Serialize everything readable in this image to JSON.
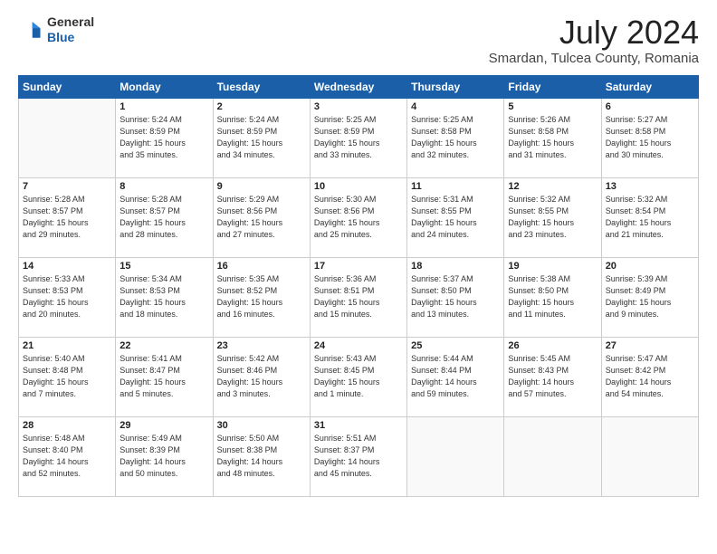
{
  "header": {
    "logo_line1": "General",
    "logo_line2": "Blue",
    "month_year": "July 2024",
    "location": "Smardan, Tulcea County, Romania"
  },
  "weekdays": [
    "Sunday",
    "Monday",
    "Tuesday",
    "Wednesday",
    "Thursday",
    "Friday",
    "Saturday"
  ],
  "weeks": [
    [
      {
        "day": "",
        "info": ""
      },
      {
        "day": "1",
        "info": "Sunrise: 5:24 AM\nSunset: 8:59 PM\nDaylight: 15 hours\nand 35 minutes."
      },
      {
        "day": "2",
        "info": "Sunrise: 5:24 AM\nSunset: 8:59 PM\nDaylight: 15 hours\nand 34 minutes."
      },
      {
        "day": "3",
        "info": "Sunrise: 5:25 AM\nSunset: 8:59 PM\nDaylight: 15 hours\nand 33 minutes."
      },
      {
        "day": "4",
        "info": "Sunrise: 5:25 AM\nSunset: 8:58 PM\nDaylight: 15 hours\nand 32 minutes."
      },
      {
        "day": "5",
        "info": "Sunrise: 5:26 AM\nSunset: 8:58 PM\nDaylight: 15 hours\nand 31 minutes."
      },
      {
        "day": "6",
        "info": "Sunrise: 5:27 AM\nSunset: 8:58 PM\nDaylight: 15 hours\nand 30 minutes."
      }
    ],
    [
      {
        "day": "7",
        "info": "Sunrise: 5:28 AM\nSunset: 8:57 PM\nDaylight: 15 hours\nand 29 minutes."
      },
      {
        "day": "8",
        "info": "Sunrise: 5:28 AM\nSunset: 8:57 PM\nDaylight: 15 hours\nand 28 minutes."
      },
      {
        "day": "9",
        "info": "Sunrise: 5:29 AM\nSunset: 8:56 PM\nDaylight: 15 hours\nand 27 minutes."
      },
      {
        "day": "10",
        "info": "Sunrise: 5:30 AM\nSunset: 8:56 PM\nDaylight: 15 hours\nand 25 minutes."
      },
      {
        "day": "11",
        "info": "Sunrise: 5:31 AM\nSunset: 8:55 PM\nDaylight: 15 hours\nand 24 minutes."
      },
      {
        "day": "12",
        "info": "Sunrise: 5:32 AM\nSunset: 8:55 PM\nDaylight: 15 hours\nand 23 minutes."
      },
      {
        "day": "13",
        "info": "Sunrise: 5:32 AM\nSunset: 8:54 PM\nDaylight: 15 hours\nand 21 minutes."
      }
    ],
    [
      {
        "day": "14",
        "info": "Sunrise: 5:33 AM\nSunset: 8:53 PM\nDaylight: 15 hours\nand 20 minutes."
      },
      {
        "day": "15",
        "info": "Sunrise: 5:34 AM\nSunset: 8:53 PM\nDaylight: 15 hours\nand 18 minutes."
      },
      {
        "day": "16",
        "info": "Sunrise: 5:35 AM\nSunset: 8:52 PM\nDaylight: 15 hours\nand 16 minutes."
      },
      {
        "day": "17",
        "info": "Sunrise: 5:36 AM\nSunset: 8:51 PM\nDaylight: 15 hours\nand 15 minutes."
      },
      {
        "day": "18",
        "info": "Sunrise: 5:37 AM\nSunset: 8:50 PM\nDaylight: 15 hours\nand 13 minutes."
      },
      {
        "day": "19",
        "info": "Sunrise: 5:38 AM\nSunset: 8:50 PM\nDaylight: 15 hours\nand 11 minutes."
      },
      {
        "day": "20",
        "info": "Sunrise: 5:39 AM\nSunset: 8:49 PM\nDaylight: 15 hours\nand 9 minutes."
      }
    ],
    [
      {
        "day": "21",
        "info": "Sunrise: 5:40 AM\nSunset: 8:48 PM\nDaylight: 15 hours\nand 7 minutes."
      },
      {
        "day": "22",
        "info": "Sunrise: 5:41 AM\nSunset: 8:47 PM\nDaylight: 15 hours\nand 5 minutes."
      },
      {
        "day": "23",
        "info": "Sunrise: 5:42 AM\nSunset: 8:46 PM\nDaylight: 15 hours\nand 3 minutes."
      },
      {
        "day": "24",
        "info": "Sunrise: 5:43 AM\nSunset: 8:45 PM\nDaylight: 15 hours\nand 1 minute."
      },
      {
        "day": "25",
        "info": "Sunrise: 5:44 AM\nSunset: 8:44 PM\nDaylight: 14 hours\nand 59 minutes."
      },
      {
        "day": "26",
        "info": "Sunrise: 5:45 AM\nSunset: 8:43 PM\nDaylight: 14 hours\nand 57 minutes."
      },
      {
        "day": "27",
        "info": "Sunrise: 5:47 AM\nSunset: 8:42 PM\nDaylight: 14 hours\nand 54 minutes."
      }
    ],
    [
      {
        "day": "28",
        "info": "Sunrise: 5:48 AM\nSunset: 8:40 PM\nDaylight: 14 hours\nand 52 minutes."
      },
      {
        "day": "29",
        "info": "Sunrise: 5:49 AM\nSunset: 8:39 PM\nDaylight: 14 hours\nand 50 minutes."
      },
      {
        "day": "30",
        "info": "Sunrise: 5:50 AM\nSunset: 8:38 PM\nDaylight: 14 hours\nand 48 minutes."
      },
      {
        "day": "31",
        "info": "Sunrise: 5:51 AM\nSunset: 8:37 PM\nDaylight: 14 hours\nand 45 minutes."
      },
      {
        "day": "",
        "info": ""
      },
      {
        "day": "",
        "info": ""
      },
      {
        "day": "",
        "info": ""
      }
    ]
  ]
}
